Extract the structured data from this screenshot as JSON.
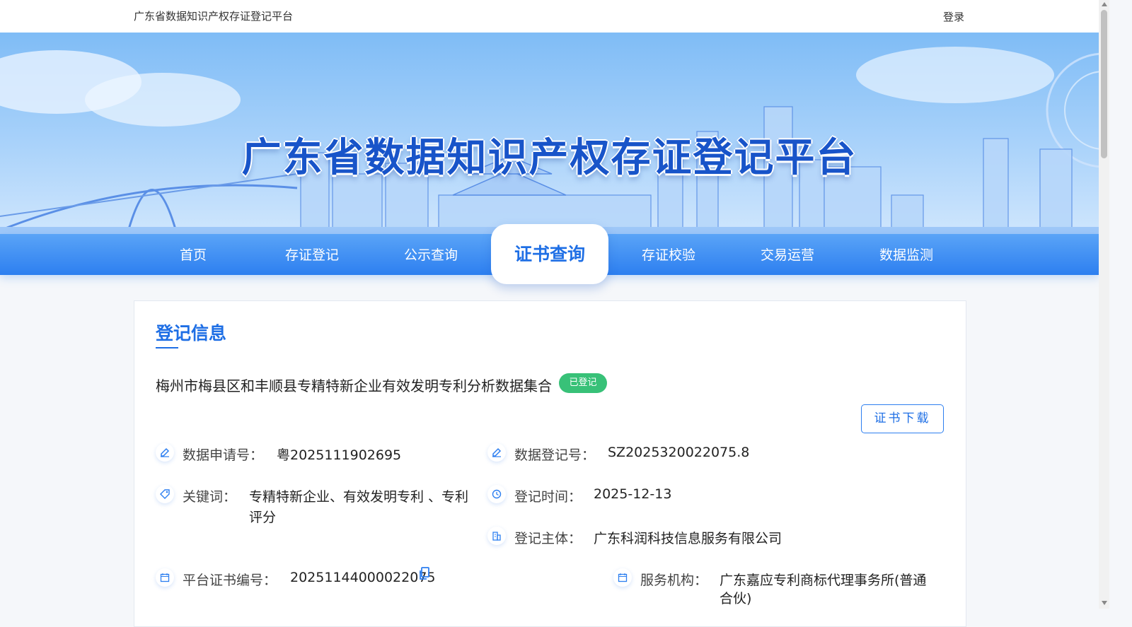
{
  "header": {
    "site_name": "广东省数据知识产权存证登记平台",
    "login_label": "登录"
  },
  "banner": {
    "title": "广东省数据知识产权存证登记平台"
  },
  "nav": {
    "items": [
      "首页",
      "存证登记",
      "公示查询",
      "证书查询",
      "存证校验",
      "交易运营",
      "数据监测"
    ],
    "active_index": 3
  },
  "record": {
    "section_title": "登记信息",
    "dataset_name": "梅州市梅县区和丰顺县专精特新企业有效发明专利分析数据集合",
    "status_badge": "已登记",
    "download_label": "证书下载",
    "fields": {
      "application_no": {
        "label": "数据申请号：",
        "value": "粤2025111902695",
        "icon": "edit-icon"
      },
      "registration_no": {
        "label": "数据登记号：",
        "value": "SZ2025320022075.8",
        "icon": "edit-icon"
      },
      "keywords": {
        "label": "关键词：",
        "value_line1": "专精特新企业、有效发明专利 、专利",
        "value_line2": "评分",
        "icon": "tag-icon"
      },
      "registration_time": {
        "label": "登记时间：",
        "value": "2025-12-13",
        "icon": "clock-icon"
      },
      "registrant": {
        "label": "登记主体：",
        "value": "广东科润科技信息服务有限公司",
        "icon": "building-icon"
      },
      "certificate_no": {
        "label": "平台证书编号：",
        "value": "20251144000022075",
        "icon": "calendar-icon"
      },
      "service_agency": {
        "label": "服务机构：",
        "value": "广东嘉应专利商标代理事务所(普通",
        "value_line2": "合伙)",
        "icon": "calendar-icon"
      }
    }
  },
  "colors": {
    "primary": "#1f6fe5",
    "nav_gradient_top": "#5aa4f7",
    "nav_gradient_bottom": "#2d7ff0",
    "badge_green": "#38c178"
  }
}
